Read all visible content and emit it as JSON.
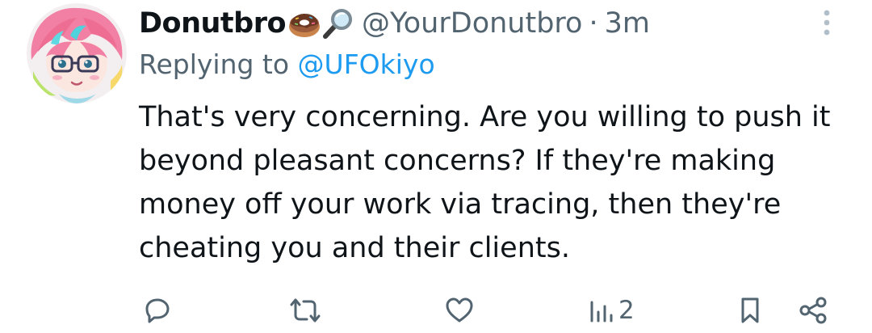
{
  "tweet": {
    "display_name": "Donutbro",
    "name_emojis": [
      "doughnut-emoji",
      "magnifying-glass-emoji"
    ],
    "handle": "@YourDonutbro",
    "separator": "·",
    "time": "3m",
    "reply_prefix": "Replying to",
    "reply_to": "@UFOkiyo",
    "text": "That's very concerning. Are you willing to push it beyond pleasant concerns? If they're making money off your work via tracing, then they're cheating you and their clients.",
    "actions": {
      "reply_icon": "speech-bubble-icon",
      "retweet_icon": "retweet-arrows-icon",
      "like_icon": "heart-icon",
      "views_icon": "bar-chart-icon",
      "views_count": "2",
      "bookmark_icon": "bookmark-icon",
      "share_icon": "share-nodes-icon"
    },
    "more_icon": "vertical-dots-icon"
  },
  "colors": {
    "text_primary": "#0f1419",
    "text_secondary": "#536471",
    "link": "#1d9bf0",
    "more_icon": "#b3bfc8"
  }
}
